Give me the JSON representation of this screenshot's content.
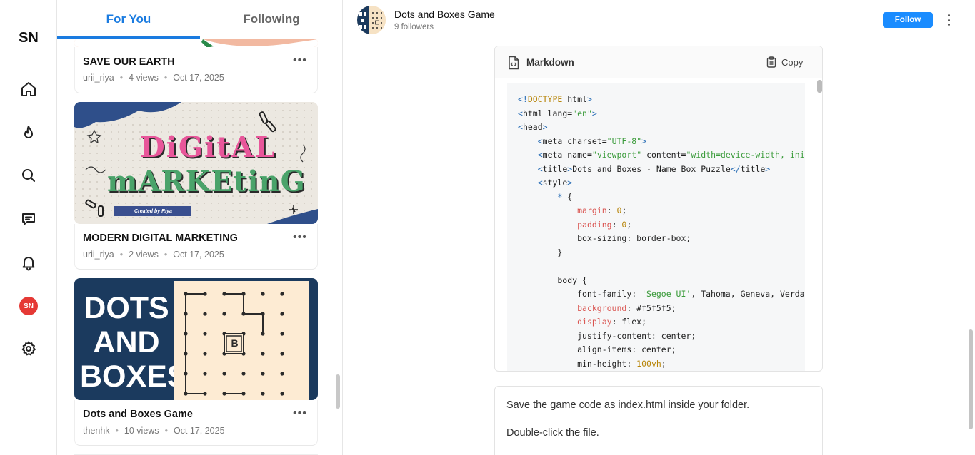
{
  "app": {
    "logo": "SN",
    "avatar_initials": "SN"
  },
  "nav": {
    "items": [
      {
        "icon": "home-icon"
      },
      {
        "icon": "flame-icon"
      },
      {
        "icon": "search-icon"
      },
      {
        "icon": "message-icon"
      },
      {
        "icon": "bell-icon"
      },
      {
        "icon": "avatar"
      },
      {
        "icon": "gear-icon"
      }
    ]
  },
  "feed": {
    "tabs": [
      {
        "label": "For You",
        "active": true
      },
      {
        "label": "Following",
        "active": false
      }
    ],
    "posts": [
      {
        "title": "SAVE OUR EARTH",
        "author": "urii_riya",
        "views": "4 views",
        "date": "Oct 17, 2025"
      },
      {
        "title": "MODERN DIGITAL MARKETING",
        "author": "urii_riya",
        "views": "2 views",
        "date": "Oct 17, 2025",
        "thumb_line1": "DiGitAL",
        "thumb_line2": "mARKEtinG",
        "thumb_credit": "Created by Riya"
      },
      {
        "title": "Dots and Boxes Game",
        "author": "thenhk",
        "views": "10 views",
        "date": "Oct 17, 2025",
        "thumb_line1": "DOTS",
        "thumb_line2": "AND",
        "thumb_line3": "BOXES",
        "thumb_box_letter": "B"
      }
    ]
  },
  "channel": {
    "name": "Dots and Boxes Game",
    "followers": "9 followers",
    "follow_label": "Follow"
  },
  "code_block": {
    "language": "Markdown",
    "copy_label": "Copy"
  },
  "instructions": [
    "Save the game code as index.html inside your folder.",
    "Double-click the file."
  ],
  "colors": {
    "accent": "#1a7be0",
    "follow_button": "#1a8cff",
    "avatar_bg": "#e53935",
    "thumb_navy": "#1b3a5e",
    "thumb_cream": "#fdebd3"
  }
}
